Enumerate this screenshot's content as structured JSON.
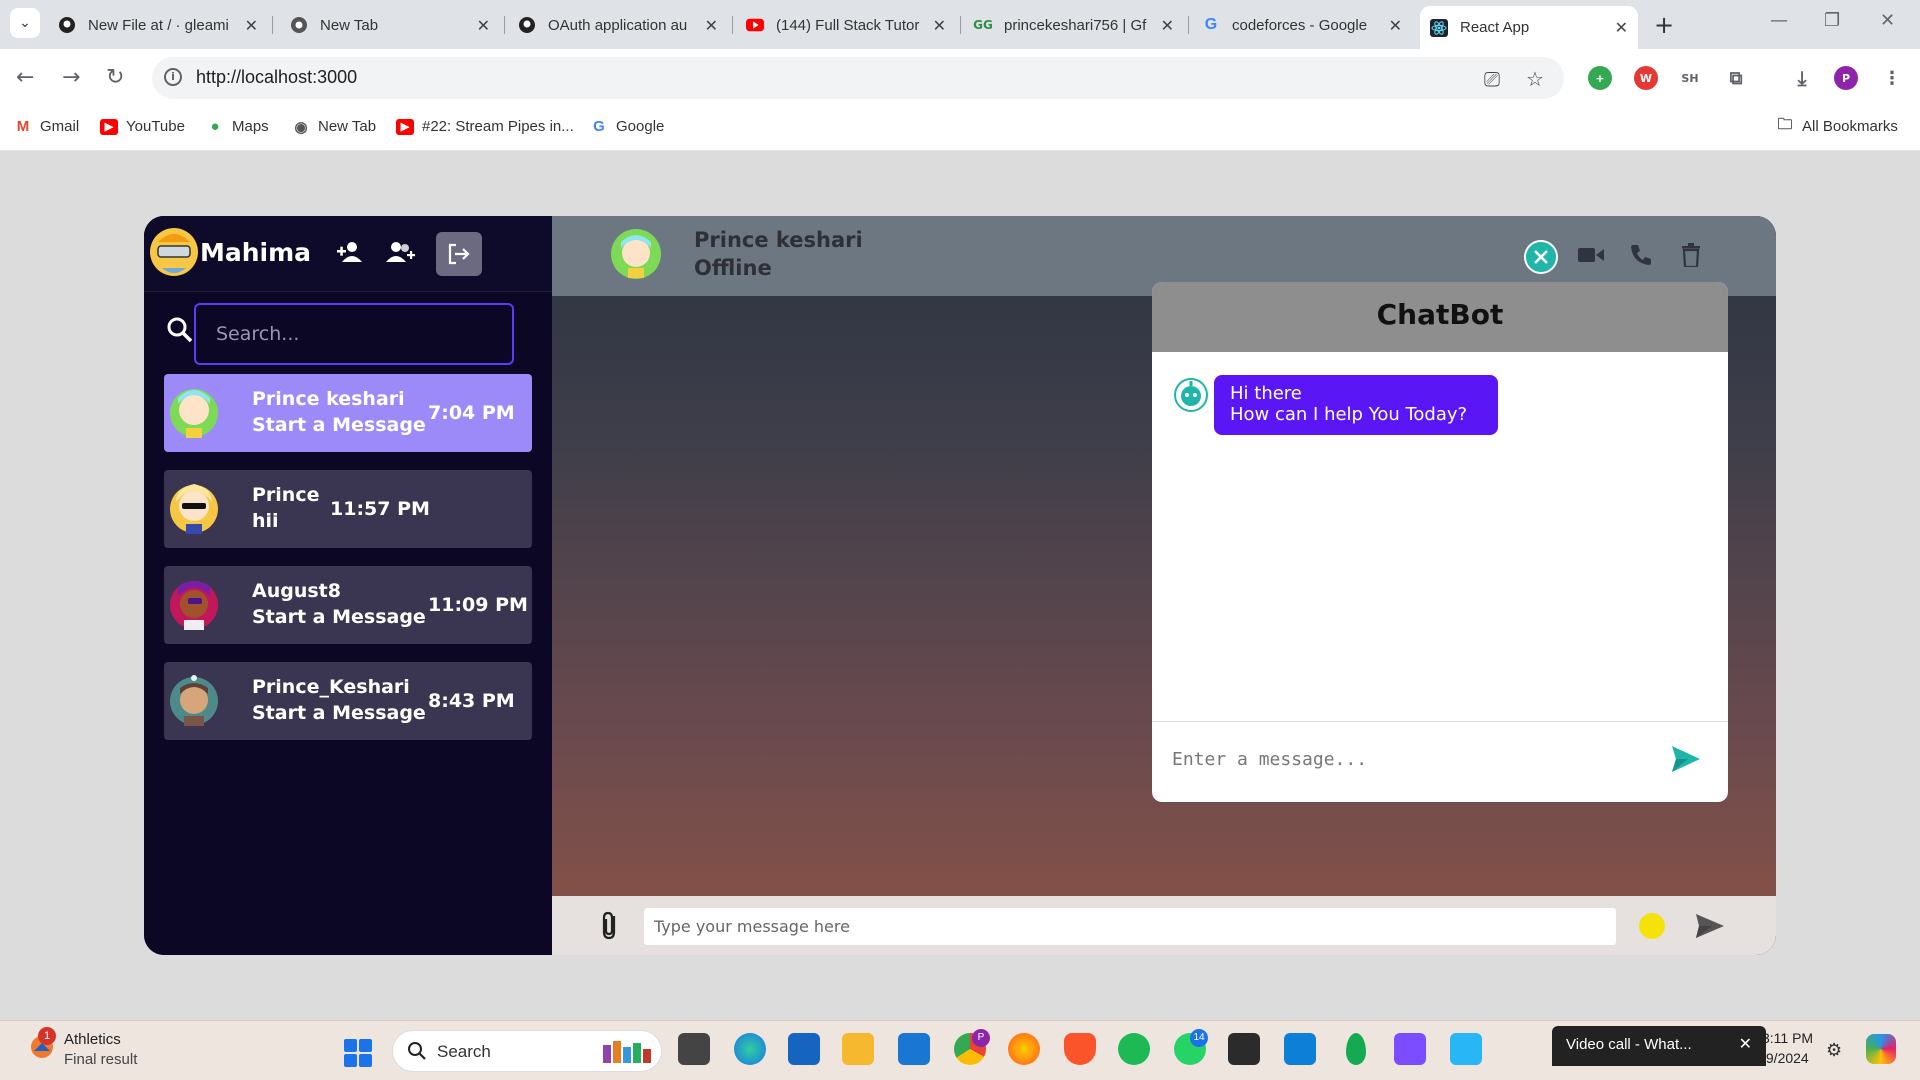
{
  "browser": {
    "tabs": [
      {
        "title": "New File at / · gleami",
        "icon": "github-icon"
      },
      {
        "title": "New Tab",
        "icon": "chrome-icon"
      },
      {
        "title": "OAuth application au",
        "icon": "github-icon"
      },
      {
        "title": "(144) Full Stack Tutor",
        "icon": "youtube-icon"
      },
      {
        "title": "princekeshari756 | Gf",
        "icon": "gfg-icon"
      },
      {
        "title": "codeforces - Google",
        "icon": "google-icon"
      },
      {
        "title": "React App",
        "icon": "react-icon",
        "active": true
      }
    ],
    "url": "http://localhost:3000",
    "extension_sh": "SH",
    "profile_initial": "P",
    "bookmarks": [
      {
        "label": "Gmail",
        "icon": "gmail-icon"
      },
      {
        "label": "YouTube",
        "icon": "youtube-icon"
      },
      {
        "label": "Maps",
        "icon": "maps-icon"
      },
      {
        "label": "New Tab",
        "icon": "chrome-icon"
      },
      {
        "label": "#22: Stream Pipes in...",
        "icon": "youtube-icon"
      },
      {
        "label": "Google",
        "icon": "google-icon"
      }
    ],
    "all_bookmarks": "All Bookmarks"
  },
  "sidebar": {
    "user_name": "Mahima",
    "search_placeholder": "Search...",
    "contacts": [
      {
        "name": "Prince keshari",
        "message": "Start a Message",
        "time": "7:04 PM",
        "selected": true
      },
      {
        "name": "Prince",
        "message": "hii",
        "time": "11:57 PM"
      },
      {
        "name": "August8",
        "message": "Start a Message",
        "time": "11:09 PM"
      },
      {
        "name": "Prince_Keshari",
        "message": "Start a Message",
        "time": "8:43 PM"
      }
    ]
  },
  "chat": {
    "peer_name": "Prince keshari",
    "peer_status": "Offline",
    "composer_placeholder": "Type your message here"
  },
  "chatbot": {
    "title": "ChatBot",
    "greeting_line1": "Hi there",
    "greeting_line2": "How can I help You Today?",
    "input_placeholder": "Enter a message..."
  },
  "taskbar": {
    "weather_badge": "1",
    "weather_title": "Athletics",
    "weather_sub": "Final result",
    "search_label": "Search",
    "whatsapp_badge": "14",
    "chrome_badge": "P",
    "toast_title": "Video call - What...",
    "time": "3:11 PM",
    "date": "/9/2024"
  },
  "colors": {
    "accent": "#5b16f5",
    "selected_contact": "#9b8af7",
    "teal": "#1fb5a9"
  }
}
